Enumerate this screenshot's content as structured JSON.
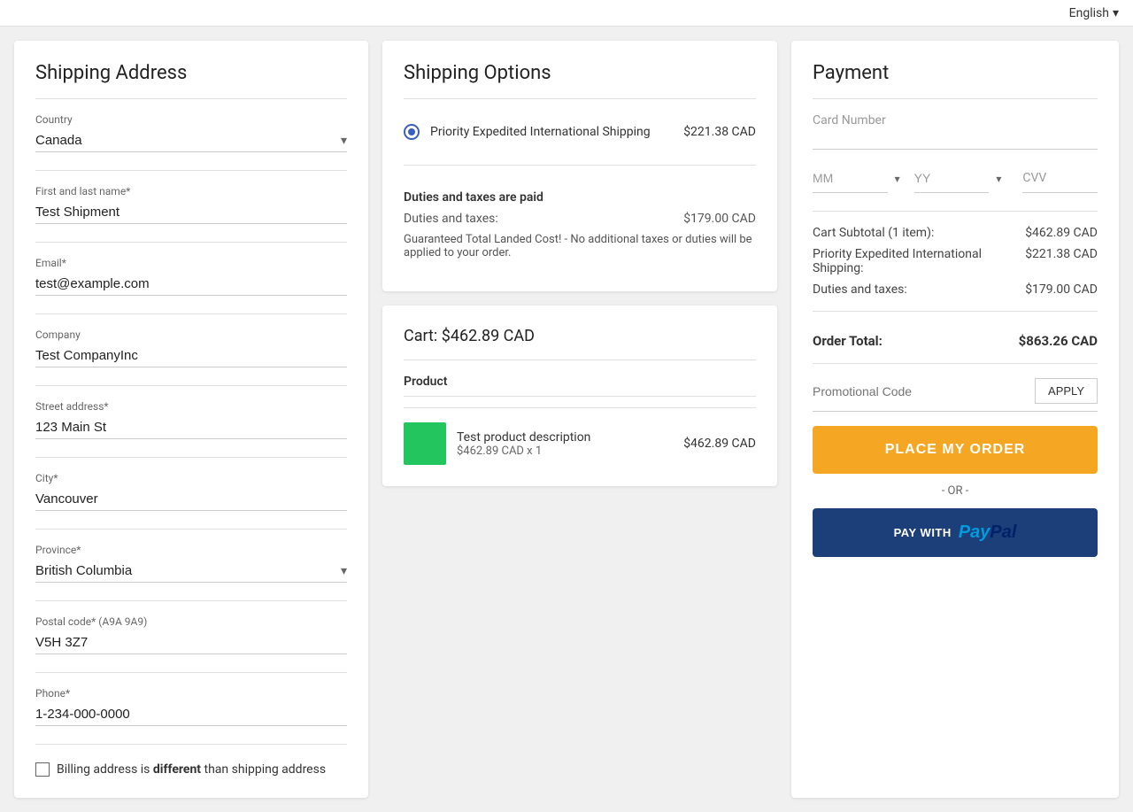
{
  "topbar": {
    "language_label": "English",
    "chevron": "▾"
  },
  "shipping_address": {
    "title": "Shipping Address",
    "country_label": "Country",
    "country_value": "Canada",
    "name_label": "First and last name*",
    "name_value": "Test Shipment",
    "email_label": "Email*",
    "email_value": "test@example.com",
    "company_label": "Company",
    "company_value": "Test CompanyInc",
    "street_label": "Street address*",
    "street_value": "123 Main St",
    "city_label": "City*",
    "city_value": "Vancouver",
    "province_label": "Province*",
    "province_value": "British Columbia",
    "postal_label": "Postal code* (A9A 9A9)",
    "postal_value": "V5H 3Z7",
    "phone_label": "Phone*",
    "phone_value": "1-234-000-0000",
    "billing_text1": "Billing address is ",
    "billing_bold": "different",
    "billing_text2": " than shipping address"
  },
  "shipping_options": {
    "title": "Shipping Options",
    "option_label": "Priority Expedited International Shipping",
    "option_price": "$221.38 CAD",
    "duties_title": "Duties and taxes are paid",
    "duties_label": "Duties and taxes:",
    "duties_price": "$179.00 CAD",
    "duties_note": "Guaranteed Total Landed Cost! - No additional taxes or duties will be applied to your order."
  },
  "cart": {
    "title": "Cart:",
    "total": "$462.89 CAD",
    "product_header": "Product",
    "product_name": "Test product description",
    "product_price": "$462.89 CAD",
    "product_qty": "$462.89 CAD x 1"
  },
  "payment": {
    "title": "Payment",
    "card_number_placeholder": "Card Number",
    "mm_placeholder": "MM",
    "yy_placeholder": "YY",
    "cvv_placeholder": "CVV",
    "subtotal_label": "Cart Subtotal (1 item):",
    "subtotal_value": "$462.89 CAD",
    "shipping_label": "Priority Expedited International Shipping:",
    "shipping_value": "$221.38 CAD",
    "duties_label": "Duties and taxes:",
    "duties_value": "$179.00 CAD",
    "order_total_label": "Order Total:",
    "order_total_value": "$863.26 CAD",
    "promo_placeholder": "Promotional Code",
    "apply_label": "APPLY",
    "place_order_label": "PLACE MY ORDER",
    "or_text": "- OR -",
    "paypal_prefix": "PAY WITH",
    "paypal_logo": "PayPal"
  }
}
